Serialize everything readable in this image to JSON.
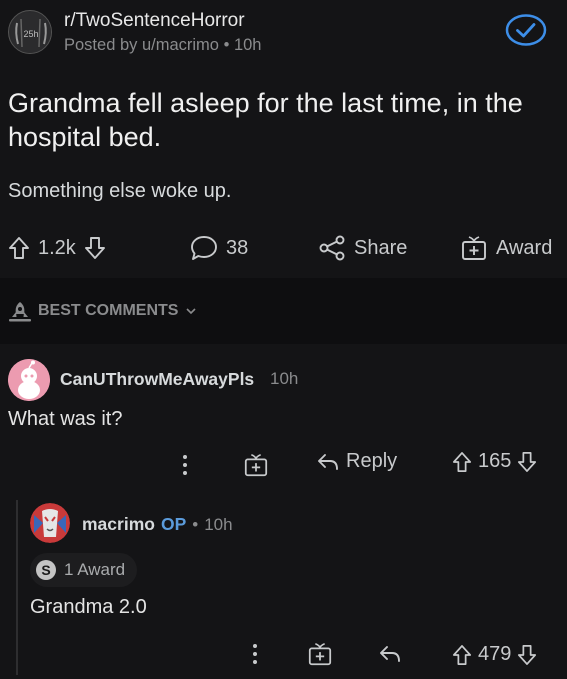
{
  "post": {
    "subreddit": "r/TwoSentenceHorror",
    "subreddit_icon_text": "25h",
    "posted_by": "Posted by u/macrimo",
    "age": "10h",
    "title": "Grandma fell asleep for the last time, in the hospital bed.",
    "body": "Something else woke up.",
    "upvotes": "1.2k",
    "comments_count": "38",
    "share_label": "Share",
    "award_label": "Award"
  },
  "comments_section": {
    "sort_label": "BEST COMMENTS"
  },
  "comments": [
    {
      "username": "CanUThrowMeAwayPls",
      "age": "10h",
      "text": "What was it?",
      "reply_label": "Reply",
      "votes": "165"
    },
    {
      "username": "macrimo",
      "op_badge": "OP",
      "age": "10h",
      "award_text": "1 Award",
      "award_icon": "S",
      "text": "Grandma 2.0",
      "votes": "479"
    }
  ],
  "colors": {
    "background": "#141416",
    "text": "#d7dadc",
    "muted": "#818384",
    "accent_blue": "#3d8ee8",
    "op_blue": "#5b9bdb",
    "avatar_pink": "#ec9bb0"
  },
  "icons": {
    "verified": "check-circle-icon",
    "upvote": "arrow-up-icon",
    "downvote": "arrow-down-icon",
    "comment": "speech-bubble-icon",
    "share": "share-nodes-icon",
    "award": "gift-icon",
    "more": "vertical-dots-icon",
    "reply": "reply-arrow-icon",
    "best": "rocket-icon"
  }
}
